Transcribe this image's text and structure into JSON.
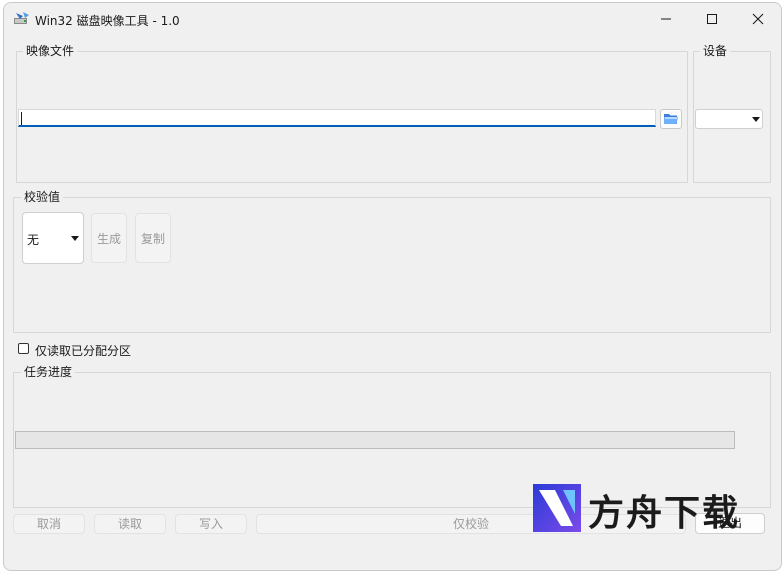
{
  "window": {
    "title": "Win32 磁盘映像工具 - 1.0",
    "controls": {
      "minimize": "minimize-icon",
      "maximize": "maximize-icon",
      "close": "close-icon"
    }
  },
  "image_file": {
    "label": "映像文件",
    "value": "",
    "browse_icon": "folder-icon"
  },
  "device": {
    "label": "设备",
    "value": ""
  },
  "hash": {
    "label": "校验值",
    "selected": "无",
    "generate_label": "生成",
    "copy_label": "复制"
  },
  "readonly_partitions": {
    "label": "仅读取已分配分区",
    "checked": false
  },
  "progress": {
    "label": "任务进度",
    "value": 0
  },
  "actions": {
    "cancel": "取消",
    "read": "读取",
    "write": "写入",
    "verify_only": "仅校验",
    "exit": "退出"
  },
  "watermark": {
    "text": "方舟下载"
  },
  "colors": {
    "accent": "#005fb8",
    "window_bg": "#f0f0f0",
    "disabled_text": "#9a9a9a"
  }
}
